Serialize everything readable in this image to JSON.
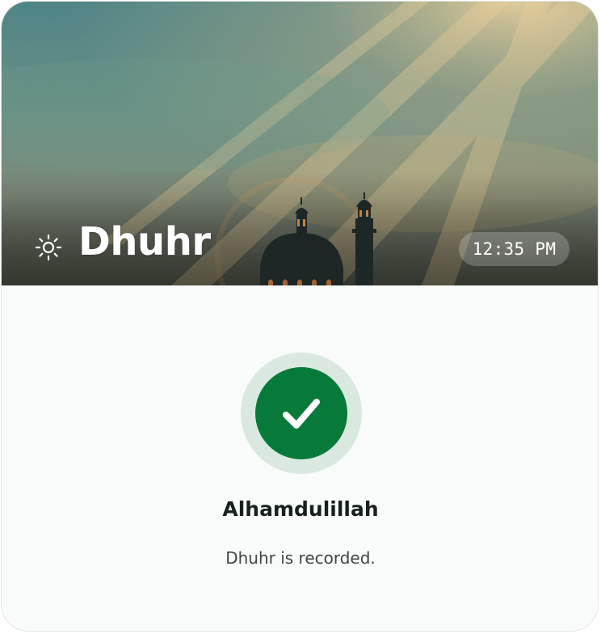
{
  "prayer": {
    "name": "Dhuhr",
    "icon": "sun-icon",
    "time": "12:35 PM"
  },
  "status": {
    "icon": "checkmark-icon",
    "title": "Alhamdulillah",
    "message": "Dhuhr is recorded."
  },
  "colors": {
    "success_green": "#077a3a",
    "success_halo": "#d9e9df",
    "card_background": "#f8fbf9"
  }
}
